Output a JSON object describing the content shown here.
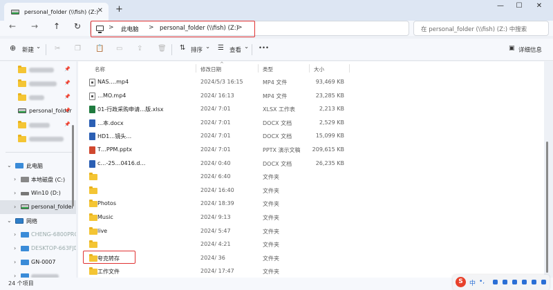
{
  "window": {
    "tab_title": "personal_folder (\\\\fish) (Z:)",
    "tab_close": "✕",
    "new_tab": "+",
    "minimize": "—",
    "maximize": "☐",
    "close": "✕"
  },
  "nav": {
    "back": "←",
    "forward": "→",
    "up": "↑",
    "refresh": "↻",
    "breadcrumbs": [
      "此电脑",
      "personal_folder (\\\\fish) (Z:)"
    ],
    "sep": ">",
    "search_placeholder": "在 personal_folder (\\\\fish) (Z:) 中搜索"
  },
  "toolbar": {
    "new_label": "新建",
    "new_caret": "⌄",
    "sort_label": "排序",
    "view_label": "查看",
    "caret": "⌄",
    "more": "•••",
    "details_label": "详细信息"
  },
  "sidebar": {
    "pinned": [
      {
        "label": "",
        "pin": "📌"
      },
      {
        "label": "",
        "pin": "📌"
      },
      {
        "label": "",
        "pin": "📌"
      },
      {
        "label": "personal_folder",
        "pin": "📌"
      },
      {
        "label": "",
        "pin": "📌"
      },
      {
        "label": "",
        "pin": ""
      }
    ],
    "this_pc": "此电脑",
    "drives": [
      {
        "label": "本地磁盘 (C:)"
      },
      {
        "label": "Win10 (D:)"
      },
      {
        "label": "personal_folder (\\"
      }
    ],
    "network": "网络",
    "network_items": [
      {
        "label": "CHENG-6800PRO"
      },
      {
        "label": "DESKTOP-663FJD"
      },
      {
        "label": "GN-0007"
      },
      {
        "label": ""
      }
    ],
    "chevron_right": "›",
    "chevron_down": "⌄"
  },
  "columns": {
    "name": "名称",
    "modified": "修改日期",
    "type": "类型",
    "size": "大小",
    "sort_caret": "^"
  },
  "files": [
    {
      "icon": "mp4",
      "name": "NAS….mp4",
      "date": "2024/5/3 16:15",
      "type": "MP4 文件",
      "size": "93,469 KB"
    },
    {
      "icon": "mp4",
      "name": "…MO.mp4",
      "date": "2024/ 16:13",
      "type": "MP4 文件",
      "size": "23,285 KB"
    },
    {
      "icon": "xlsx",
      "name": "01-行政采购申请…版.xlsx",
      "date": "2024/ 7:01",
      "type": "XLSX 工作表",
      "size": "2,213 KB"
    },
    {
      "icon": "docx",
      "name": "…本.docx",
      "date": "2024/ 7:01",
      "type": "DOCX 文档",
      "size": "2,529 KB"
    },
    {
      "icon": "docx",
      "name": "HD1…镜头…",
      "date": "2024/ 7:01",
      "type": "DOCX 文档",
      "size": "15,099 KB"
    },
    {
      "icon": "pptx",
      "name": "T…PPM.pptx",
      "date": "2024/ 7:01",
      "type": "PPTX 演示文稿",
      "size": "209,615 KB"
    },
    {
      "icon": "docx",
      "name": "c…-25…0416.d…",
      "date": "2024/ 0:40",
      "type": "DOCX 文档",
      "size": "26,235 KB"
    },
    {
      "icon": "folder",
      "name": "",
      "date": "2024/ 6:40",
      "type": "文件夹",
      "size": ""
    },
    {
      "icon": "folder",
      "name": "",
      "date": "2024/ 16:40",
      "type": "文件夹",
      "size": ""
    },
    {
      "icon": "folder",
      "name": "Photos",
      "date": "2024/ 18:39",
      "type": "文件夹",
      "size": ""
    },
    {
      "icon": "folder",
      "name": "Music",
      "date": "2024/ 9:13",
      "type": "文件夹",
      "size": ""
    },
    {
      "icon": "folder",
      "name": "live",
      "date": "2024/ 5:47",
      "type": "文件夹",
      "size": ""
    },
    {
      "icon": "folder",
      "name": "",
      "date": "2024/ 4:21",
      "type": "文件夹",
      "size": ""
    },
    {
      "icon": "folder",
      "name": "夸克转存",
      "date": "2024/ 36",
      "type": "文件夹",
      "size": "",
      "highlight": true
    },
    {
      "icon": "folder",
      "name": "工作文件",
      "date": "2024/ 17:47",
      "type": "文件夹",
      "size": ""
    }
  ],
  "status": {
    "item_count": "24 个项目"
  },
  "ime": {
    "logo": "S",
    "lang": "中",
    "punct": "•,"
  },
  "colors": {
    "accent": "#2b6fd6",
    "highlight_box": "#e03030",
    "folder": "#f4c534"
  }
}
